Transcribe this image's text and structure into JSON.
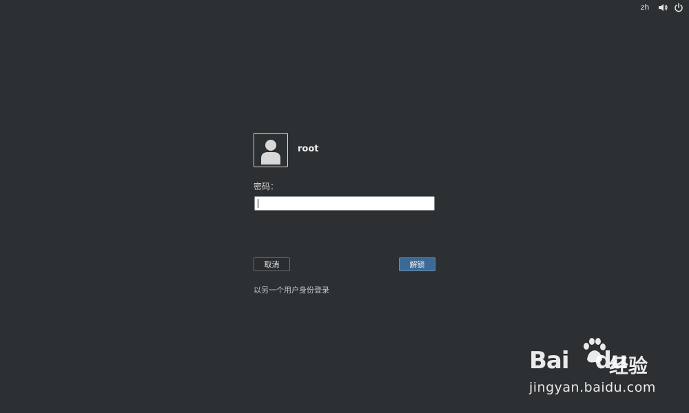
{
  "topbar": {
    "language": "zh",
    "volume_icon": "volume-icon",
    "power_icon": "power-icon"
  },
  "login": {
    "avatar_icon": "user-avatar-icon",
    "username": "root",
    "password_label": "密码：",
    "password_value": "",
    "cancel_label": "取消",
    "unlock_label": "解锁",
    "other_user_link": "以另一个用户身份登录"
  },
  "watermark": {
    "brand": "Bai",
    "brand_suffix": "du",
    "brand_cn": "经验",
    "url": "jingyan.baidu.com"
  },
  "colors": {
    "background": "#2c3033",
    "unlock_button": "#3c6a97"
  }
}
